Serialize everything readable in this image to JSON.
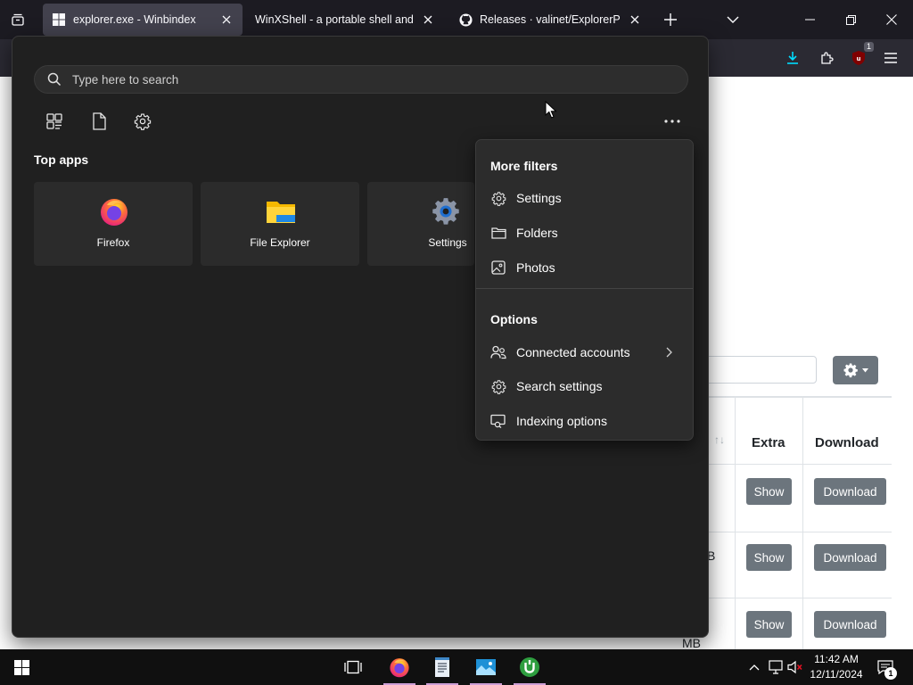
{
  "browser": {
    "tabs": [
      {
        "title": "explorer.exe - Winbindex",
        "active": true,
        "favicon": "windows-logo-icon"
      },
      {
        "title": "WinXShell - a portable shell and zero",
        "active": false,
        "favicon": "none"
      },
      {
        "title": "Releases · valinet/ExplorerPatcher",
        "active": false,
        "favicon": "github-icon"
      }
    ],
    "ublock_count": "1"
  },
  "page": {
    "table_headers": {
      "extra": "Extra",
      "download": "Download"
    },
    "rows": [
      {
        "size_fragment": "",
        "show_label": "Show",
        "download_label": "Download"
      },
      {
        "size_fragment": "B",
        "show_label": "Show",
        "download_label": "Download"
      },
      {
        "size_fragment": "MB",
        "show_label": "Show",
        "download_label": "Download"
      }
    ],
    "sort_glyph": "↑↓"
  },
  "search": {
    "placeholder": "Type here to search",
    "filter_icons": [
      "apps-filter-icon",
      "documents-filter-icon",
      "settings-filter-icon"
    ],
    "top_apps_title": "Top apps",
    "top_apps": [
      {
        "label": "Firefox",
        "icon": "firefox-icon"
      },
      {
        "label": "File Explorer",
        "icon": "file-explorer-icon"
      },
      {
        "label": "Settings",
        "icon": "settings-gear-icon"
      }
    ]
  },
  "menu": {
    "filters_heading": "More filters",
    "filters": [
      {
        "label": "Settings",
        "icon": "gear-icon"
      },
      {
        "label": "Folders",
        "icon": "folder-icon"
      },
      {
        "label": "Photos",
        "icon": "photo-icon"
      }
    ],
    "options_heading": "Options",
    "options": [
      {
        "label": "Connected accounts",
        "icon": "people-icon",
        "submenu": true
      },
      {
        "label": "Search settings",
        "icon": "gear-icon",
        "submenu": false
      },
      {
        "label": "Indexing options",
        "icon": "indexing-icon",
        "submenu": false
      }
    ]
  },
  "taskbar": {
    "time": "11:42 AM",
    "date": "12/11/2024",
    "notification_count": "1",
    "pinned": [
      "task-view-icon",
      "firefox-icon",
      "notepad-icon",
      "photos-icon",
      "utorrent-icon"
    ]
  },
  "colors": {
    "flyout_bg": "#202020",
    "menu_bg": "#2c2c2c",
    "tile_bg": "#2b2b2b",
    "taskbar_bg": "#101010",
    "accent_running": "#cc9ed5",
    "page_button": "#6c757d"
  }
}
